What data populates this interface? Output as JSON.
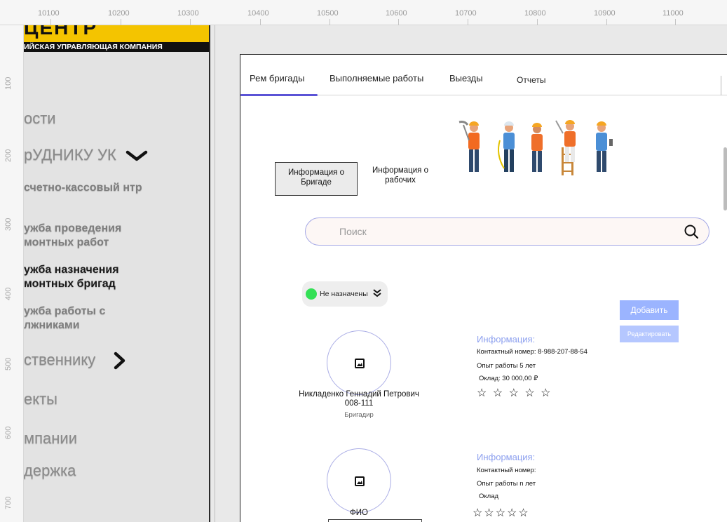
{
  "ruler": {
    "top": [
      "10100",
      "10200",
      "10300",
      "10400",
      "10500",
      "10600",
      "10700",
      "10800",
      "10900",
      "11000"
    ],
    "left": [
      "100",
      "200",
      "300",
      "400",
      "500",
      "600",
      "700"
    ]
  },
  "sidebar": {
    "logo_glyphs": "ЦЕНТР",
    "logo_subtitle": "ИЙСКАЯ УПРАВЛЯЮЩАЯ КОМПАНИЯ",
    "items": [
      {
        "label": "ости"
      },
      {
        "label": "рУДНИКУ УК"
      },
      {
        "label": "счетно-кассовый нтр"
      },
      {
        "label": "ужба проведения монтных работ"
      },
      {
        "label": "ужба назначения монтных бригад"
      },
      {
        "label": "ужба работы с лжниками"
      },
      {
        "label": "ственнику"
      },
      {
        "label": "екты"
      },
      {
        "label": "мпании"
      },
      {
        "label": "держка"
      }
    ]
  },
  "tabs": [
    {
      "label": "Рем бригады"
    },
    {
      "label": "Выполняемые работы"
    },
    {
      "label": "Выезды"
    },
    {
      "label": "Отчеты"
    }
  ],
  "panel_buttons": {
    "brigade_info": "Информация о Бригаде",
    "workers_info": "Информация о рабочих"
  },
  "search": {
    "placeholder": "Поиск"
  },
  "filter": {
    "label": "Не назначены",
    "status_color": "#34e056"
  },
  "actions": {
    "add": "Добавить",
    "edit": "Редактировать"
  },
  "members": [
    {
      "name": "Никладенко Геннадий Петрович",
      "code": "008-111",
      "role": "Бригадир",
      "info_title": "Информация:",
      "phone": "Контактный номер: 8-988-207-88-54",
      "experience": "Опыт работы 5 лет",
      "salary": "Оклад: 30 000,00 ₽",
      "stars": "☆ ☆ ☆ ☆ ☆"
    },
    {
      "name": "ФИО",
      "info_title": "Информация:",
      "phone": "Контактный номер:",
      "experience": "Опыт работы n лет",
      "salary": "Оклад",
      "stars": "☆☆☆☆☆"
    }
  ],
  "colors": {
    "accent": "#5b53d6",
    "add_button": "#9bb4ff",
    "info_title": "#8da0ef"
  }
}
